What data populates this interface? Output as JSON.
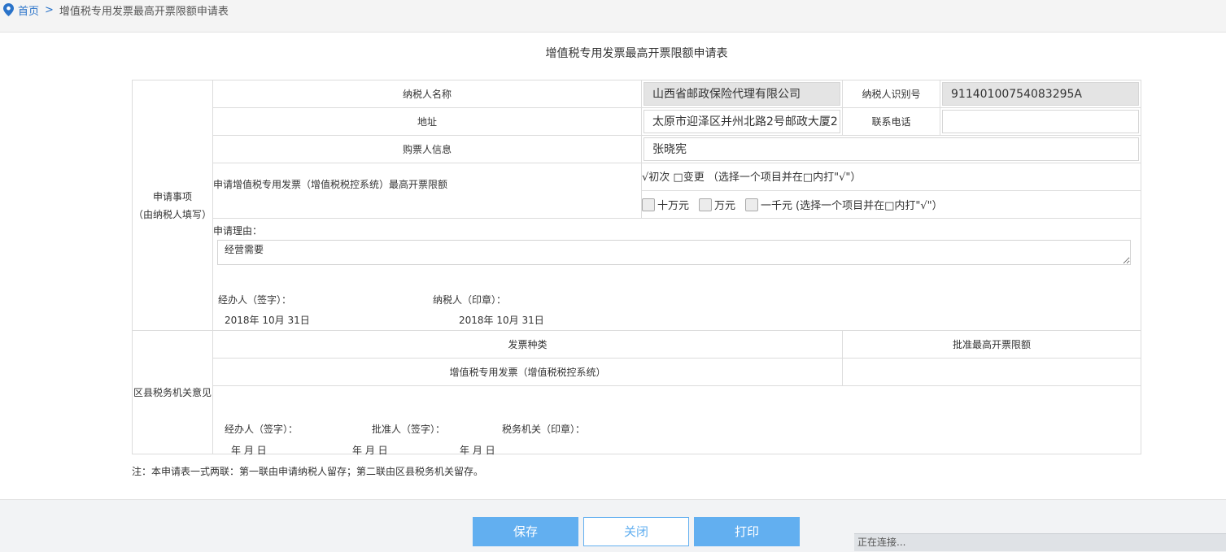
{
  "breadcrumb": {
    "home": "首页",
    "separator": ">",
    "current": "增值税专用发票最高开票限额申请表"
  },
  "form": {
    "title": "增值税专用发票最高开票限额申请表",
    "section1": {
      "label_line1": "申请事项",
      "label_line2": "（由纳税人填写）"
    },
    "taxpayer_name_label": "纳税人名称",
    "taxpayer_name_value": "山西省邮政保险代理有限公司",
    "taxpayer_id_label": "纳税人识别号",
    "taxpayer_id_value": "91140100754083295A",
    "address_label": "地址",
    "address_value": "太原市迎泽区并州北路2号邮政大厦2",
    "phone_label": "联系电话",
    "phone_value": "",
    "buyer_label": "购票人信息",
    "buyer_value": "张晓宪",
    "limit_label": "申请增值税专用发票（增值税税控系统）最高开票限额",
    "type_options_text": "√初次 □变更 （选择一个项目并在□内打\"√\"）",
    "amount_options": [
      "十万元",
      "万元",
      "一千元"
    ],
    "amount_note": "(选择一个项目并在□内打\"√\"）",
    "reason_label": "申请理由：",
    "reason_value": "经营需要",
    "handler_label": "经办人（签字）：",
    "taxpayer_seal_label": "纳税人（印章）：",
    "handler_date": "2018年 10月 31日",
    "taxpayer_date": "2018年 10月 31日",
    "section2": {
      "label": "区县税务机关意见"
    },
    "invoice_type_header": "发票种类",
    "approved_limit_header": "批准最高开票限额",
    "invoice_type_value": "增值税专用发票（增值税税控系统）",
    "approved_limit_value": "",
    "s2_handler_label": "经办人（签字）：",
    "s2_approver_label": "批准人（签字）：",
    "s2_authority_label": "税务机关（印章）：",
    "s2_date1": "年 月 日",
    "s2_date2": "年 月 日",
    "s2_date3": "年 月 日"
  },
  "note": "注：本申请表一式两联：第一联由申请纳税人留存；第二联由区县税务机关留存。",
  "buttons": {
    "save": "保存",
    "close": "关闭",
    "print": "打印"
  },
  "status": "正在连接..."
}
